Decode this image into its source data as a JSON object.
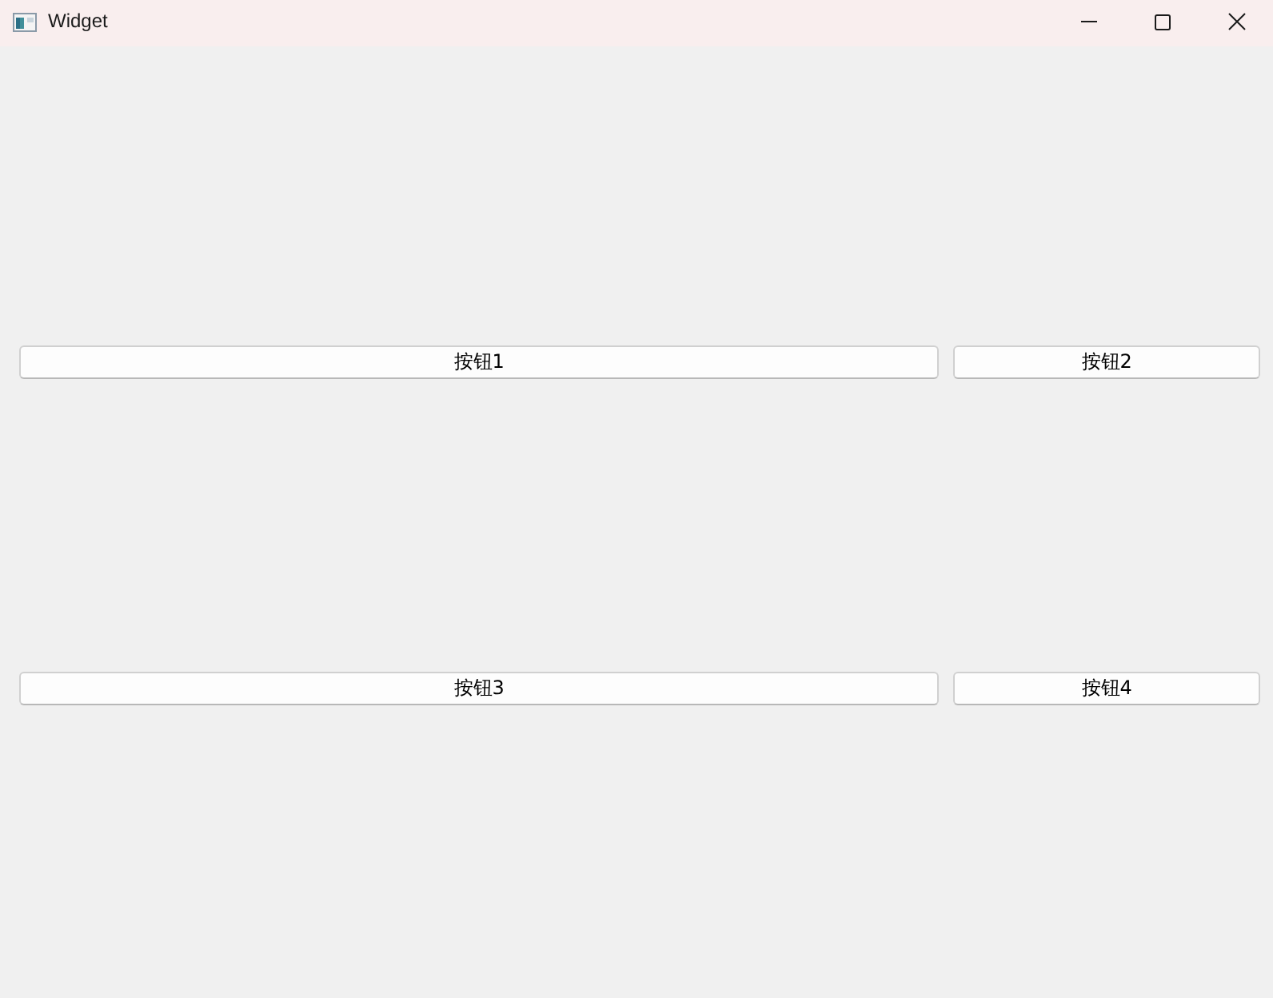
{
  "window": {
    "title": "Widget"
  },
  "buttons": [
    {
      "label": "按钮1"
    },
    {
      "label": "按钮2"
    },
    {
      "label": "按钮3"
    },
    {
      "label": "按钮4"
    }
  ]
}
